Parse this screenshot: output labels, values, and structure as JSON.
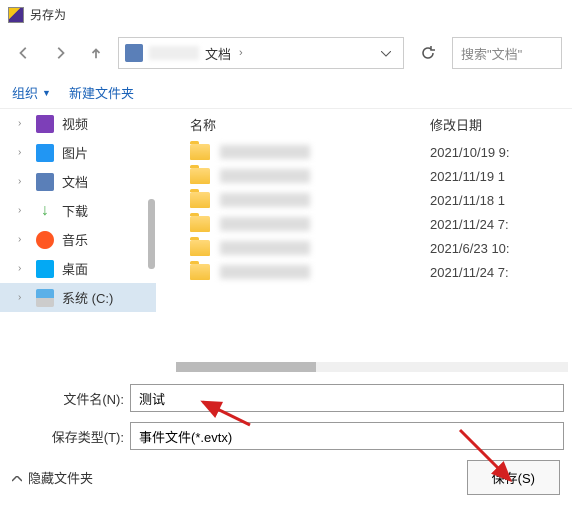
{
  "window": {
    "title": "另存为"
  },
  "breadcrumb": {
    "current": "文档"
  },
  "search": {
    "placeholder": "搜索\"文档\""
  },
  "toolbar": {
    "organize": "组织",
    "new_folder": "新建文件夹"
  },
  "sidebar": {
    "items": [
      {
        "label": "视频"
      },
      {
        "label": "图片"
      },
      {
        "label": "文档"
      },
      {
        "label": "下载"
      },
      {
        "label": "音乐"
      },
      {
        "label": "桌面"
      },
      {
        "label": "系统 (C:)"
      }
    ]
  },
  "filelist": {
    "col_name": "名称",
    "col_date": "修改日期",
    "rows": [
      {
        "date": "2021/10/19 9:"
      },
      {
        "date": "2021/11/19 1"
      },
      {
        "date": "2021/11/18 1"
      },
      {
        "date": "2021/11/24 7:"
      },
      {
        "date": "2021/6/23 10:"
      },
      {
        "date": "2021/11/24 7:"
      }
    ]
  },
  "form": {
    "filename_label": "文件名(N):",
    "filename_value": "测试",
    "filetype_label": "保存类型(T):",
    "filetype_value": "事件文件(*.evtx)"
  },
  "bottom": {
    "hide_folders": "隐藏文件夹",
    "save": "保存(S)"
  }
}
